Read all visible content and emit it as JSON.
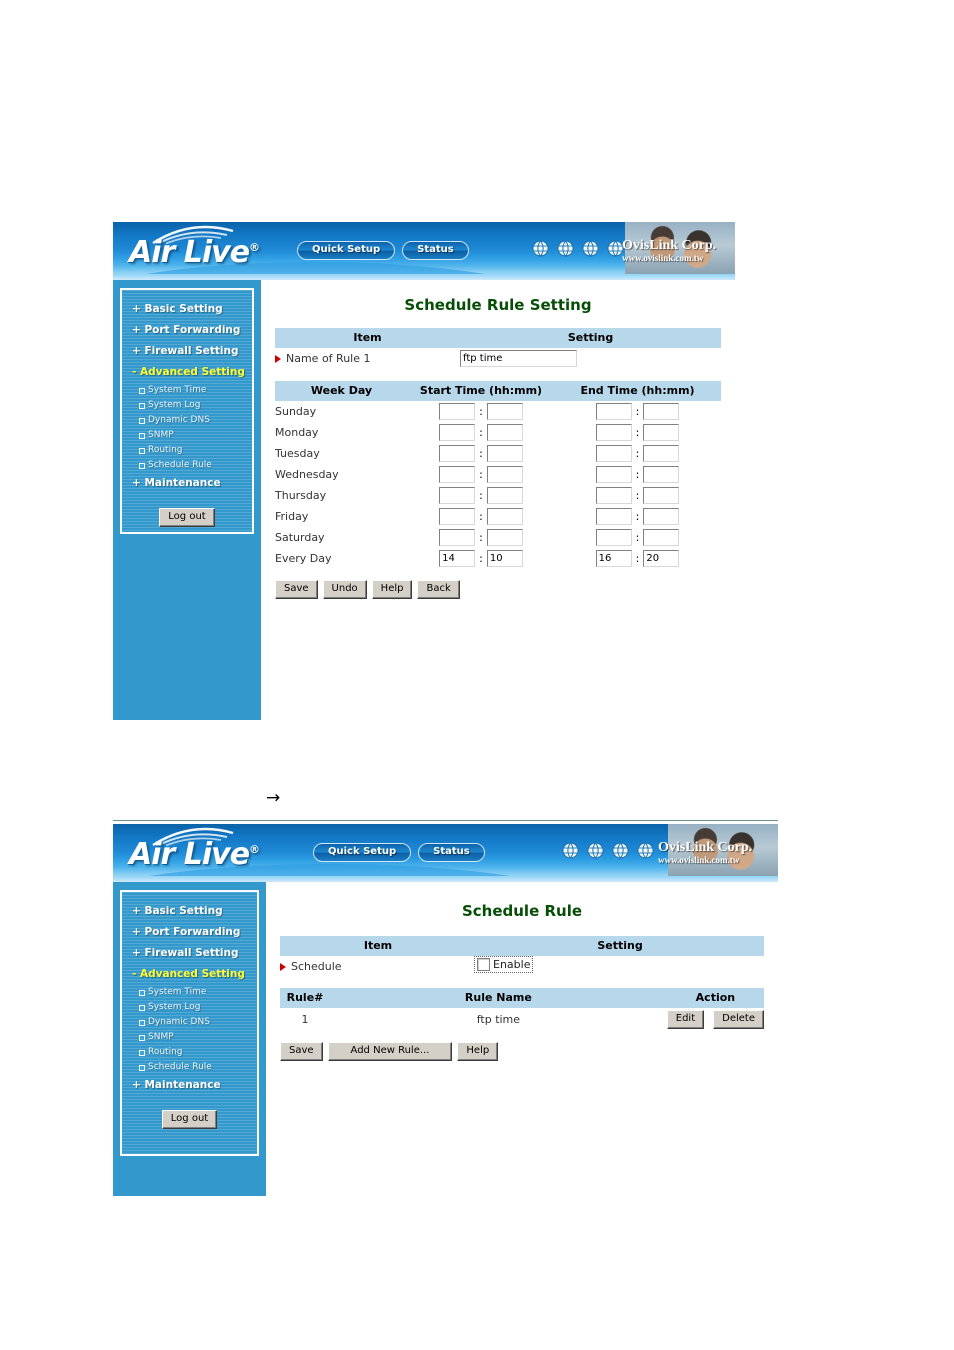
{
  "banner": {
    "logo_text": "Air Live",
    "logo_registered": "®",
    "nav": [
      {
        "label": "Quick Setup"
      },
      {
        "label": "Status"
      }
    ],
    "globe_icons": [
      "globe-icon",
      "globe-icon",
      "globe-icon",
      "globe-icon"
    ],
    "corp_name": "OvisLink Corp.",
    "corp_url": "www.ovislink.com.tw"
  },
  "sidebar": {
    "items": [
      {
        "label": "+ Basic Setting",
        "type": "top",
        "active": false
      },
      {
        "label": "+ Port Forwarding",
        "type": "top",
        "active": false
      },
      {
        "label": "+ Firewall Setting",
        "type": "top",
        "active": false
      },
      {
        "label": "- Advanced Setting",
        "type": "top",
        "active": true
      },
      {
        "label": "System Time",
        "type": "sub"
      },
      {
        "label": "System Log",
        "type": "sub"
      },
      {
        "label": "Dynamic DNS",
        "type": "sub"
      },
      {
        "label": "SNMP",
        "type": "sub"
      },
      {
        "label": "Routing",
        "type": "sub"
      },
      {
        "label": "Schedule Rule",
        "type": "sub"
      },
      {
        "label": "+ Maintenance",
        "type": "top",
        "active": false
      }
    ],
    "logout_label": "Log out"
  },
  "panel1": {
    "title": "Schedule Rule Setting",
    "item_header": "Item",
    "setting_header": "Setting",
    "rule_name_label": "Name of Rule 1",
    "rule_name_value": "ftp time",
    "weekday_header": "Week Day",
    "start_header": "Start Time (hh:mm)",
    "end_header": "End Time (hh:mm)",
    "colon": ":",
    "rows": [
      {
        "day": "Sunday",
        "start_h": "",
        "start_m": "",
        "end_h": "",
        "end_m": ""
      },
      {
        "day": "Monday",
        "start_h": "",
        "start_m": "",
        "end_h": "",
        "end_m": ""
      },
      {
        "day": "Tuesday",
        "start_h": "",
        "start_m": "",
        "end_h": "",
        "end_m": ""
      },
      {
        "day": "Wednesday",
        "start_h": "",
        "start_m": "",
        "end_h": "",
        "end_m": ""
      },
      {
        "day": "Thursday",
        "start_h": "",
        "start_m": "",
        "end_h": "",
        "end_m": ""
      },
      {
        "day": "Friday",
        "start_h": "",
        "start_m": "",
        "end_h": "",
        "end_m": ""
      },
      {
        "day": "Saturday",
        "start_h": "",
        "start_m": "",
        "end_h": "",
        "end_m": ""
      },
      {
        "day": "Every Day",
        "start_h": "14",
        "start_m": "10",
        "end_h": "16",
        "end_m": "20"
      }
    ],
    "buttons": [
      {
        "label": "Save"
      },
      {
        "label": "Undo"
      },
      {
        "label": "Help"
      },
      {
        "label": "Back"
      }
    ]
  },
  "panel2": {
    "title": "Schedule Rule",
    "item_header": "Item",
    "setting_header": "Setting",
    "schedule_label": "Schedule",
    "enable_label": "Enable",
    "enable_checked": false,
    "rule_num_header": "Rule#",
    "rule_name_header": "Rule Name",
    "action_header": "Action",
    "rules": [
      {
        "num": "1",
        "name": "ftp time",
        "edit_label": "Edit",
        "delete_label": "Delete"
      }
    ],
    "buttons": [
      {
        "label": "Save"
      },
      {
        "label": "Add New Rule..."
      },
      {
        "label": "Help"
      }
    ]
  },
  "flow": {
    "arrow": "→"
  },
  "colors": {
    "sidebar_blue": "#3399cc",
    "table_header_blue": "#b6d8ea",
    "title_green": "#064e06",
    "active_nav_yellow": "#ffff33",
    "red_arrow": "#cc0000"
  }
}
